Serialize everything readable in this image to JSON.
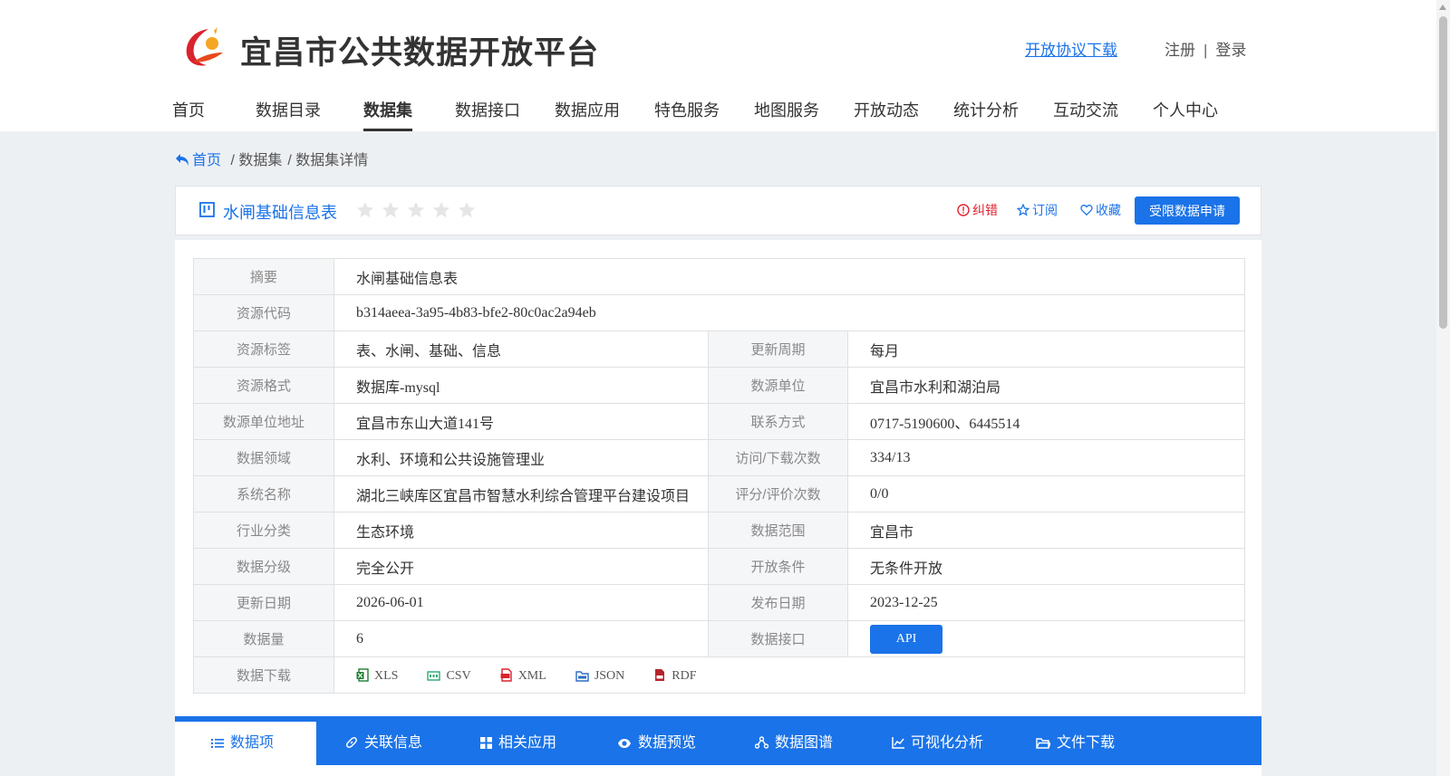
{
  "header": {
    "site_title": "宜昌市公共数据开放平台",
    "agreement_link": "开放协议下载",
    "register": "注册",
    "separator": "|",
    "login": "登录"
  },
  "nav": {
    "items": [
      "首页",
      "数据目录",
      "数据集",
      "数据接口",
      "数据应用",
      "特色服务",
      "地图服务",
      "开放动态",
      "统计分析",
      "互动交流",
      "个人中心"
    ],
    "active_index": 2
  },
  "breadcrumb": {
    "home": "首页",
    "level1": "/ 数据集",
    "level2": "/ 数据集详情"
  },
  "dataset": {
    "name": "水闸基础信息表",
    "rating_stars": 0,
    "rating_max": 5,
    "actions": {
      "report": "纠错",
      "subscribe": "订阅",
      "favorite": "收藏",
      "apply": "受限数据申请"
    }
  },
  "info": {
    "summary_label": "摘要",
    "summary": "水闸基础信息表",
    "code_label": "资源代码",
    "code": "b314aeea-3a95-4b83-bfe2-80c0ac2a94eb",
    "rows": [
      {
        "l1": "资源标签",
        "v1": "表、水闸、基础、信息",
        "l2": "更新周期",
        "v2": "每月"
      },
      {
        "l1": "资源格式",
        "v1": "数据库-mysql",
        "l2": "数源单位",
        "v2": "宜昌市水利和湖泊局"
      },
      {
        "l1": "数源单位地址",
        "v1": "宜昌市东山大道141号",
        "l2": "联系方式",
        "v2": "0717-5190600、6445514"
      },
      {
        "l1": "数据领域",
        "v1": "水利、环境和公共设施管理业",
        "l2": "访问/下载次数",
        "v2": "334/13"
      },
      {
        "l1": "系统名称",
        "v1": "湖北三峡库区宜昌市智慧水利综合管理平台建设项目",
        "l2": "评分/评价次数",
        "v2": "0/0"
      },
      {
        "l1": "行业分类",
        "v1": "生态环境",
        "l2": "数据范围",
        "v2": "宜昌市"
      },
      {
        "l1": "数据分级",
        "v1": "完全公开",
        "l2": "开放条件",
        "v2": "无条件开放"
      },
      {
        "l1": "更新日期",
        "v1": "2026-06-01",
        "l2": "发布日期",
        "v2": "2023-12-25"
      }
    ],
    "volume_label": "数据量",
    "volume": "6",
    "interface_label": "数据接口",
    "interface_button": "API",
    "download_label": "数据下载",
    "downloads": [
      {
        "label": "XLS",
        "icon": "excel-icon",
        "color": "#1e7e34"
      },
      {
        "label": "CSV",
        "icon": "csv-icon",
        "color": "#2aa876"
      },
      {
        "label": "XML",
        "icon": "xml-icon",
        "color": "#d9232d"
      },
      {
        "label": "JSON",
        "icon": "json-icon",
        "color": "#2b6cc4"
      },
      {
        "label": "RDF",
        "icon": "rdf-icon",
        "color": "#b5242b"
      }
    ]
  },
  "tabs": [
    {
      "label": "数据项",
      "icon": "list-icon"
    },
    {
      "label": "关联信息",
      "icon": "link-icon"
    },
    {
      "label": "相关应用",
      "icon": "grid-icon"
    },
    {
      "label": "数据预览",
      "icon": "eye-icon"
    },
    {
      "label": "数据图谱",
      "icon": "graph-icon"
    },
    {
      "label": "可视化分析",
      "icon": "chart-icon"
    },
    {
      "label": "文件下载",
      "icon": "folder-icon"
    }
  ],
  "colors": {
    "primary": "#1a73e8",
    "report_red": "#e0242f",
    "page_bg": "#edf0f3",
    "label_bg": "#f5f6f8"
  }
}
